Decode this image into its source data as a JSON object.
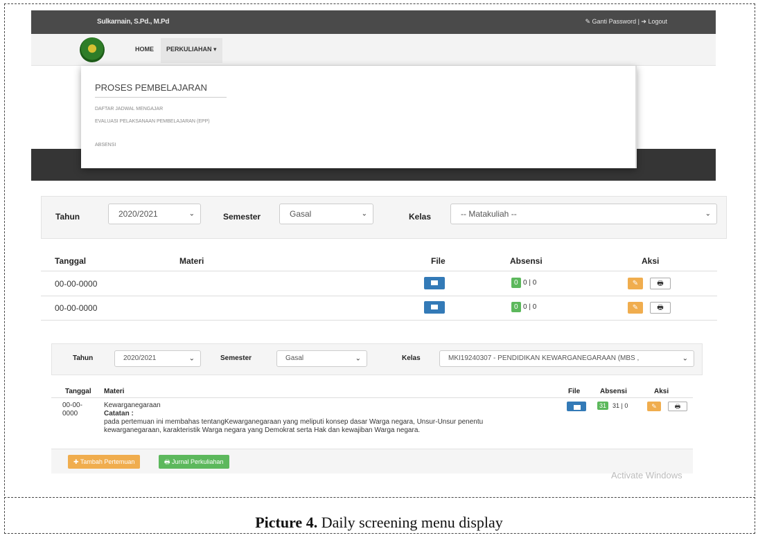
{
  "screen1": {
    "user_name": "Sulkarnain, S.Pd., M.Pd",
    "top_right": "✎ Ganti Password | ➔ Logout",
    "nav": {
      "home": "HOME",
      "perkuliahan": "PERKULIAHAN ▾"
    },
    "dropdown": {
      "title": "PROSES PEMBELAJARAN",
      "items": [
        "DAFTAR JADWAL MENGAJAR",
        "EVALUASI PELAKSANAAN PEMBELAJARAN (EPP)",
        "ABSENSI"
      ]
    }
  },
  "screen2": {
    "filter": {
      "tahun_label": "Tahun",
      "tahun_value": "2020/2021",
      "semester_label": "Semester",
      "semester_value": "Gasal",
      "kelas_label": "Kelas",
      "kelas_value": "-- Matakuliah --"
    },
    "columns": {
      "tanggal": "Tanggal",
      "materi": "Materi",
      "file": "File",
      "absensi": "Absensi",
      "aksi": "Aksi"
    },
    "rows": [
      {
        "tanggal": "00-00-0000",
        "badge": "0",
        "absensi": "0 | 0"
      },
      {
        "tanggal": "00-00-0000",
        "badge": "0",
        "absensi": "0 | 0"
      }
    ]
  },
  "screen3": {
    "filter": {
      "tahun_label": "Tahun",
      "tahun_value": "2020/2021",
      "semester_label": "Semester",
      "semester_value": "Gasal",
      "kelas_label": "Kelas",
      "kelas_value": "MKI19240307 - PENDIDIKAN KEWARGANEGARAAN (MBS ,"
    },
    "columns": {
      "tanggal": "Tanggal",
      "materi": "Materi",
      "file": "File",
      "absensi": "Absensi",
      "aksi": "Aksi"
    },
    "row": {
      "tanggal_1": "00-00-",
      "tanggal_2": "0000",
      "materi": "Kewarganegaraan",
      "catatan_label": "Catatan :",
      "catatan_1": "pada pertemuan ini membahas tentangKewarganegaraan yang meliputi konsep dasar Warga negara, Unsur-Unsur penentu",
      "catatan_2": "kewarganegaraan, karakteristik Warga negara yang Demokrat serta Hak dan kewajiban Warga negara.",
      "badge": "31",
      "absensi": "31 | 0"
    },
    "buttons": {
      "tambah": "✚ Tambah Pertemuan",
      "jurnal": "🖶 Jurnal Perkuliahan"
    },
    "watermark": "Activate Windows"
  },
  "caption": {
    "label": "Picture 4.",
    "text": "Daily screening menu display"
  }
}
